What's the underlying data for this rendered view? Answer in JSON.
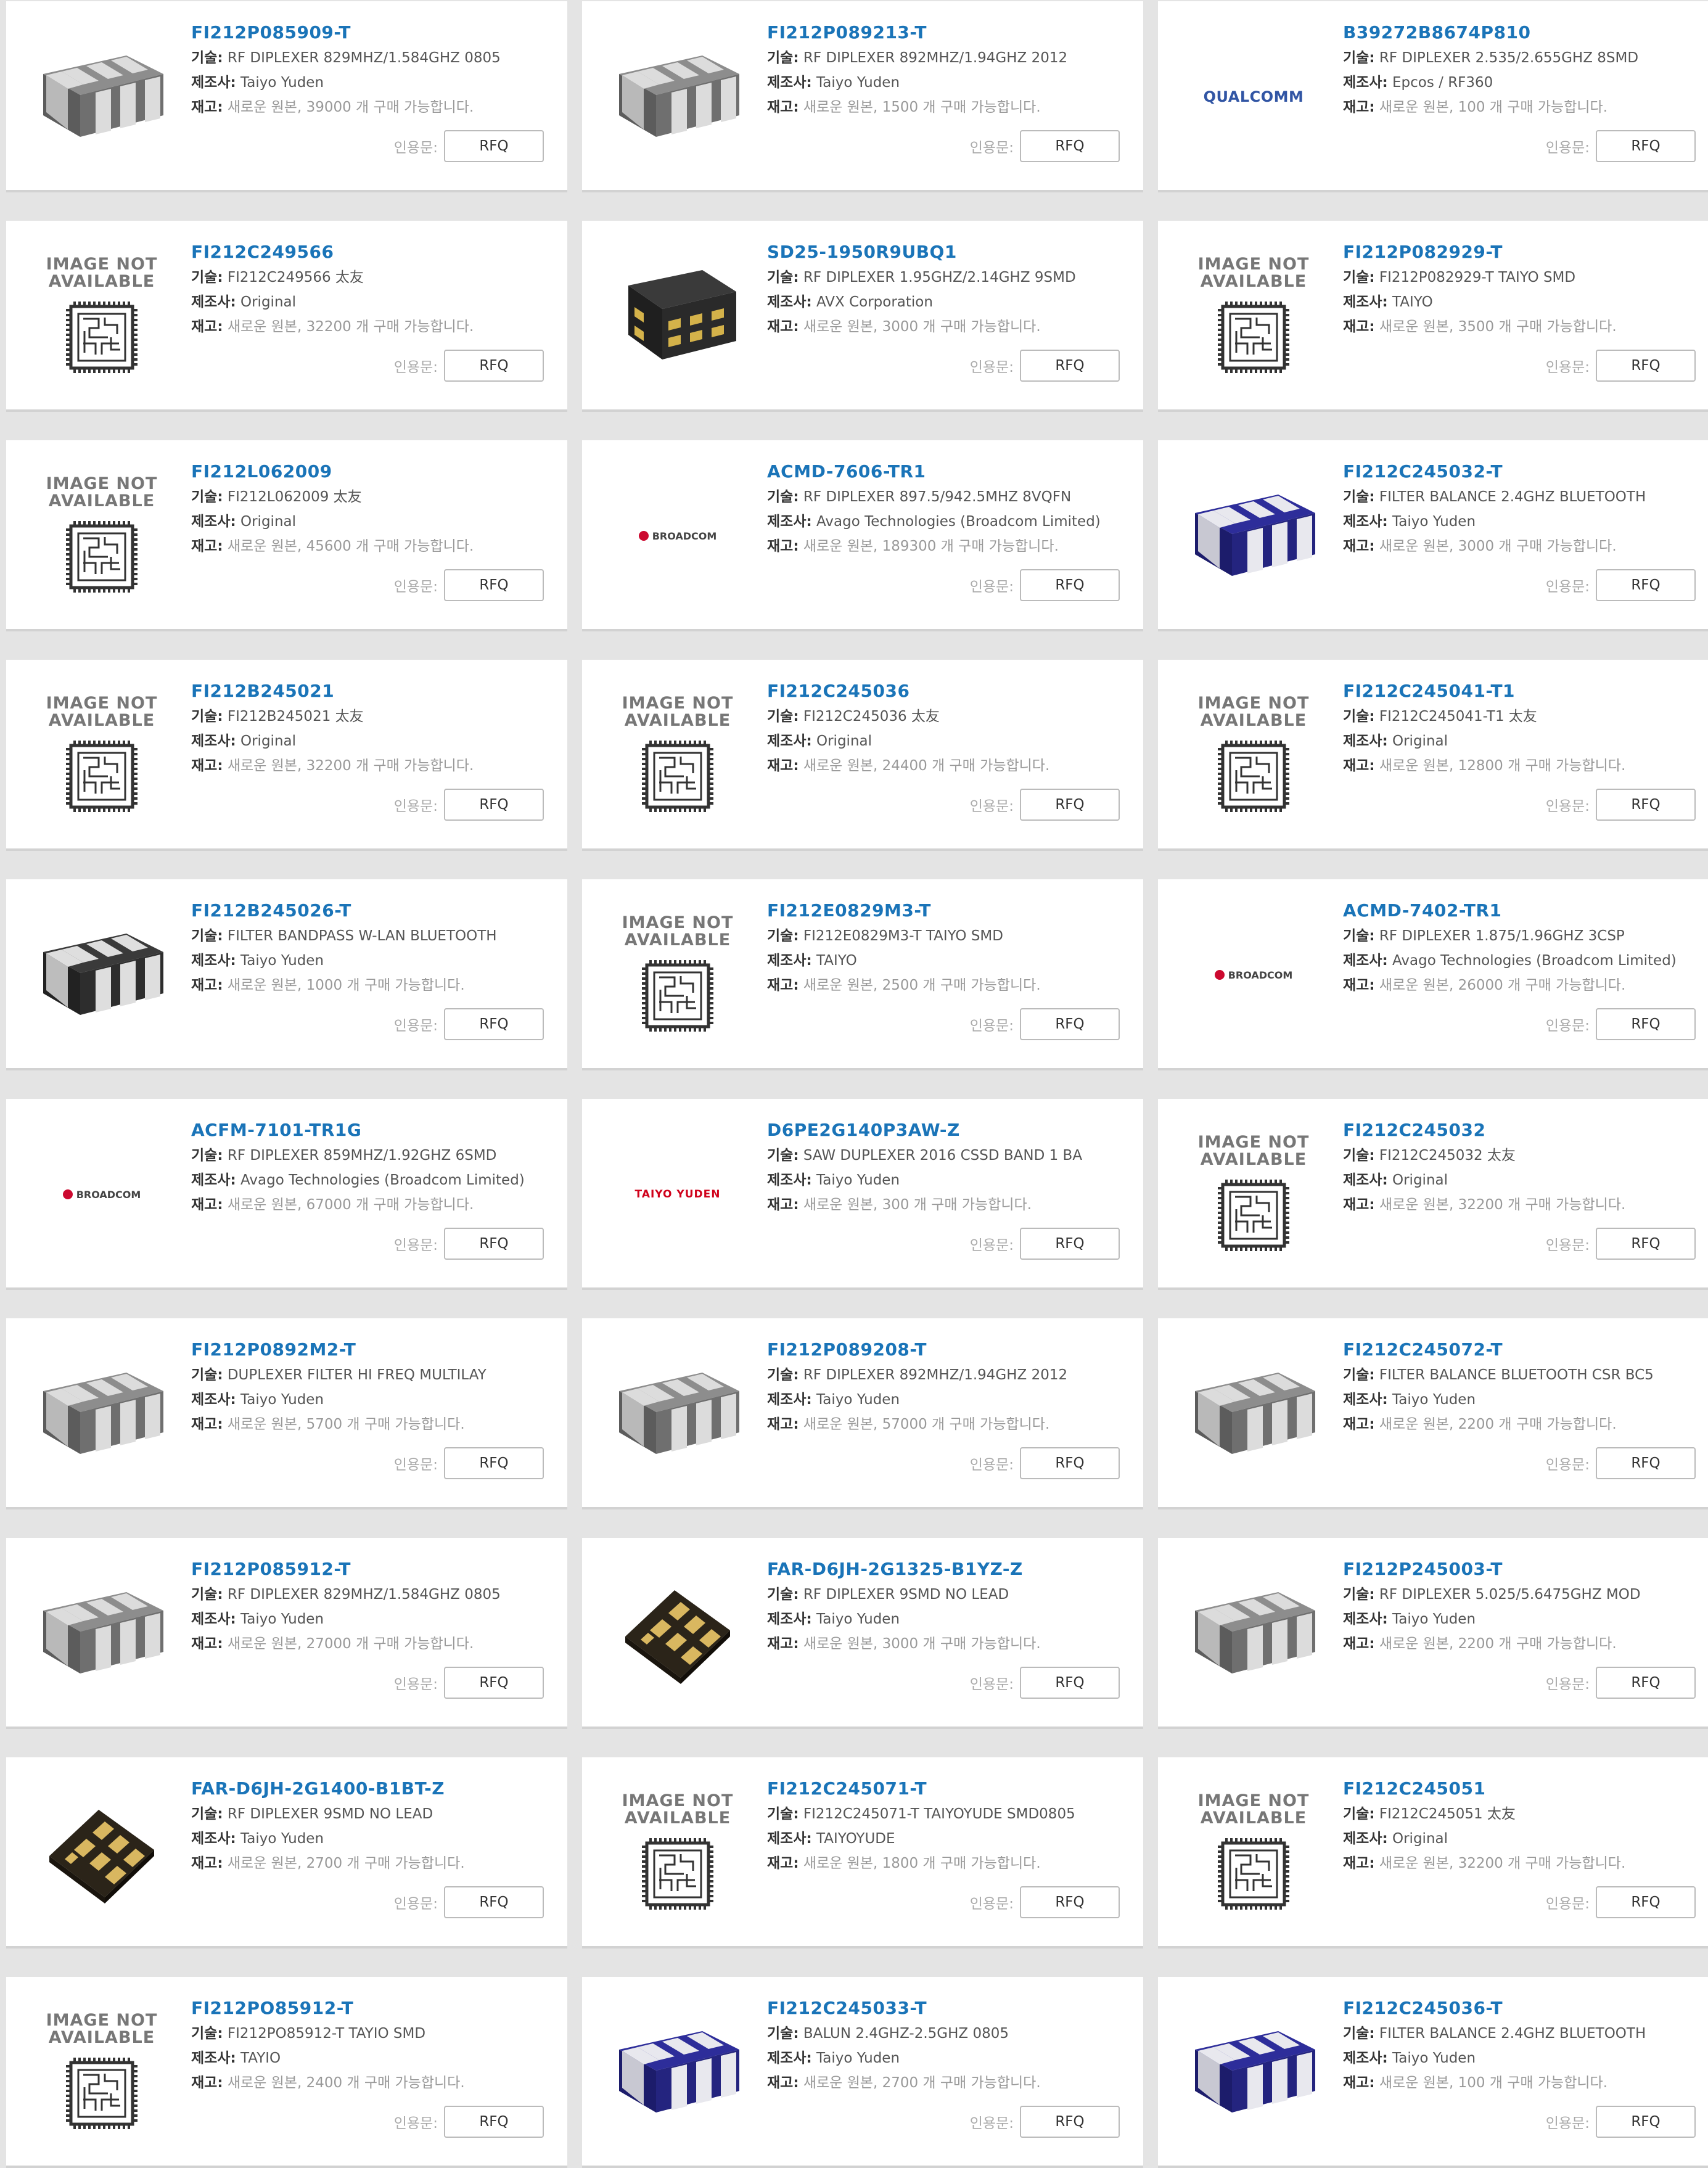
{
  "labels": {
    "tech": "기술:",
    "maker": "제조사:",
    "stock": "재고:",
    "quote": "인용문:",
    "rfq": "RFQ",
    "na_line1": "IMAGE NOT",
    "na_line2": "AVAILABLE"
  },
  "logos": {
    "qualcomm": "QUALCOMM",
    "broadcom": "BROADCOM",
    "taiyo": "TAIYO YUDEN"
  },
  "colors": {
    "link": "#1a74b8",
    "stock": "#999999",
    "broadcom_red": "#cc092f"
  },
  "products": [
    {
      "pn": "FI212P085909-T",
      "tech": "RF DIPLEXER 829MHZ/1.584GHZ 0805",
      "maker": "Taiyo Yuden",
      "stock": "새로운 원본, 39000 개 구매 가능합니다.",
      "image": "chip-gray"
    },
    {
      "pn": "FI212P089213-T",
      "tech": "RF DIPLEXER 892MHZ/1.94GHZ 2012",
      "maker": "Taiyo Yuden",
      "stock": "새로운 원본, 1500 개 구매 가능합니다.",
      "image": "chip-gray"
    },
    {
      "pn": "B39272B8674P810",
      "tech": "RF DIPLEXER 2.535/2.655GHZ 8SMD",
      "maker": "Epcos / RF360",
      "stock": "새로운 원본, 100 개 구매 가능합니다.",
      "image": "logo-qualcomm"
    },
    {
      "pn": "FI212C249566",
      "tech": "FI212C249566 太友",
      "maker": "Original",
      "stock": "새로운 원본, 32200 개 구매 가능합니다.",
      "image": "na"
    },
    {
      "pn": "SD25-1950R9UBQ1",
      "tech": "RF DIPLEXER 1.95GHZ/2.14GHZ 9SMD",
      "maker": "AVX Corporation",
      "stock": "새로운 원본, 3000 개 구매 가능합니다.",
      "image": "chip-black"
    },
    {
      "pn": "FI212P082929-T",
      "tech": "FI212P082929-T TAIYO SMD",
      "maker": "TAIYO",
      "stock": "새로운 원본, 3500 개 구매 가능합니다.",
      "image": "na"
    },
    {
      "pn": "FI212L062009",
      "tech": "FI212L062009 太友",
      "maker": "Original",
      "stock": "새로운 원본, 45600 개 구매 가능합니다.",
      "image": "na"
    },
    {
      "pn": "ACMD-7606-TR1",
      "tech": "RF DIPLEXER 897.5/942.5MHZ 8VQFN",
      "maker": "Avago Technologies (Broadcom Limited)",
      "stock": "새로운 원본, 189300 개 구매 가능합니다.",
      "image": "logo-broadcom"
    },
    {
      "pn": "FI212C245032-T",
      "tech": "FILTER BALANCE 2.4GHZ BLUETOOTH",
      "maker": "Taiyo Yuden",
      "stock": "새로운 원본, 3000 개 구매 가능합니다.",
      "image": "chip-blue"
    },
    {
      "pn": "FI212B245021",
      "tech": "FI212B245021 太友",
      "maker": "Original",
      "stock": "새로운 원본, 32200 개 구매 가능합니다.",
      "image": "na"
    },
    {
      "pn": "FI212C245036",
      "tech": "FI212C245036 太友",
      "maker": "Original",
      "stock": "새로운 원본, 24400 개 구매 가능합니다.",
      "image": "na"
    },
    {
      "pn": "FI212C245041-T1",
      "tech": "FI212C245041-T1 太友",
      "maker": "Original",
      "stock": "새로운 원본, 12800 개 구매 가능합니다.",
      "image": "na"
    },
    {
      "pn": "FI212B245026-T",
      "tech": "FILTER BANDPASS W-LAN BLUETOOTH",
      "maker": "Taiyo Yuden",
      "stock": "새로운 원본, 1000 개 구매 가능합니다.",
      "image": "chip-dark"
    },
    {
      "pn": "FI212E0829M3-T",
      "tech": "FI212E0829M3-T TAIYO SMD",
      "maker": "TAIYO",
      "stock": "새로운 원본, 2500 개 구매 가능합니다.",
      "image": "na"
    },
    {
      "pn": "ACMD-7402-TR1",
      "tech": "RF DIPLEXER 1.875/1.96GHZ 3CSP",
      "maker": "Avago Technologies (Broadcom Limited)",
      "stock": "새로운 원본, 26000 개 구매 가능합니다.",
      "image": "logo-broadcom"
    },
    {
      "pn": "ACFM-7101-TR1G",
      "tech": "RF DIPLEXER 859MHZ/1.92GHZ 6SMD",
      "maker": "Avago Technologies (Broadcom Limited)",
      "stock": "새로운 원본, 67000 개 구매 가능합니다.",
      "image": "logo-broadcom"
    },
    {
      "pn": "D6PE2G140P3AW-Z",
      "tech": "SAW DUPLEXER 2016 CSSD BAND 1 BA",
      "maker": "Taiyo Yuden",
      "stock": "새로운 원본, 300 개 구매 가능합니다.",
      "image": "logo-taiyo"
    },
    {
      "pn": "FI212C245032",
      "tech": "FI212C245032 太友",
      "maker": "Original",
      "stock": "새로운 원본, 32200 개 구매 가능합니다.",
      "image": "na"
    },
    {
      "pn": "FI212P0892M2-T",
      "tech": "DUPLEXER FILTER HI FREQ MULTILAY",
      "maker": "Taiyo Yuden",
      "stock": "새로운 원본, 5700 개 구매 가능합니다.",
      "image": "chip-gray"
    },
    {
      "pn": "FI212P089208-T",
      "tech": "RF DIPLEXER 892MHZ/1.94GHZ 2012",
      "maker": "Taiyo Yuden",
      "stock": "새로운 원본, 57000 개 구매 가능합니다.",
      "image": "chip-gray"
    },
    {
      "pn": "FI212C245072-T",
      "tech": "FILTER BALANCE BLUETOOTH CSR BC5",
      "maker": "Taiyo Yuden",
      "stock": "새로운 원본, 2200 개 구매 가능합니다.",
      "image": "chip-gray"
    },
    {
      "pn": "FI212P085912-T",
      "tech": "RF DIPLEXER 829MHZ/1.584GHZ 0805",
      "maker": "Taiyo Yuden",
      "stock": "새로운 원본, 27000 개 구매 가능합니다.",
      "image": "chip-gray"
    },
    {
      "pn": "FAR-D6JH-2G1325-B1YZ-Z",
      "tech": "RF DIPLEXER 9SMD NO LEAD",
      "maker": "Taiyo Yuden",
      "stock": "새로운 원본, 3000 개 구매 가능합니다.",
      "image": "chip-pads"
    },
    {
      "pn": "FI212P245003-T",
      "tech": "RF DIPLEXER 5.025/5.6475GHZ MOD",
      "maker": "Taiyo Yuden",
      "stock": "새로운 원본, 2200 개 구매 가능합니다.",
      "image": "chip-gray"
    },
    {
      "pn": "FAR-D6JH-2G1400-B1BT-Z",
      "tech": "RF DIPLEXER 9SMD NO LEAD",
      "maker": "Taiyo Yuden",
      "stock": "새로운 원본, 2700 개 구매 가능합니다.",
      "image": "chip-pads"
    },
    {
      "pn": "FI212C245071-T",
      "tech": "FI212C245071-T TAIYOYUDE SMD0805",
      "maker": "TAIYOYUDE",
      "stock": "새로운 원본, 1800 개 구매 가능합니다.",
      "image": "na"
    },
    {
      "pn": "FI212C245051",
      "tech": "FI212C245051 太友",
      "maker": "Original",
      "stock": "새로운 원본, 32200 개 구매 가능합니다.",
      "image": "na"
    },
    {
      "pn": "FI212PO85912-T",
      "tech": "FI212PO85912-T TAYIO SMD",
      "maker": "TAYIO",
      "stock": "새로운 원본, 2400 개 구매 가능합니다.",
      "image": "na"
    },
    {
      "pn": "FI212C245033-T",
      "tech": "BALUN 2.4GHZ-2.5GHZ 0805",
      "maker": "Taiyo Yuden",
      "stock": "새로운 원본, 2700 개 구매 가능합니다.",
      "image": "chip-blue"
    },
    {
      "pn": "FI212C245036-T",
      "tech": "FILTER BALANCE 2.4GHZ BLUETOOTH",
      "maker": "Taiyo Yuden",
      "stock": "새로운 원본, 100 개 구매 가능합니다.",
      "image": "chip-blue"
    }
  ]
}
